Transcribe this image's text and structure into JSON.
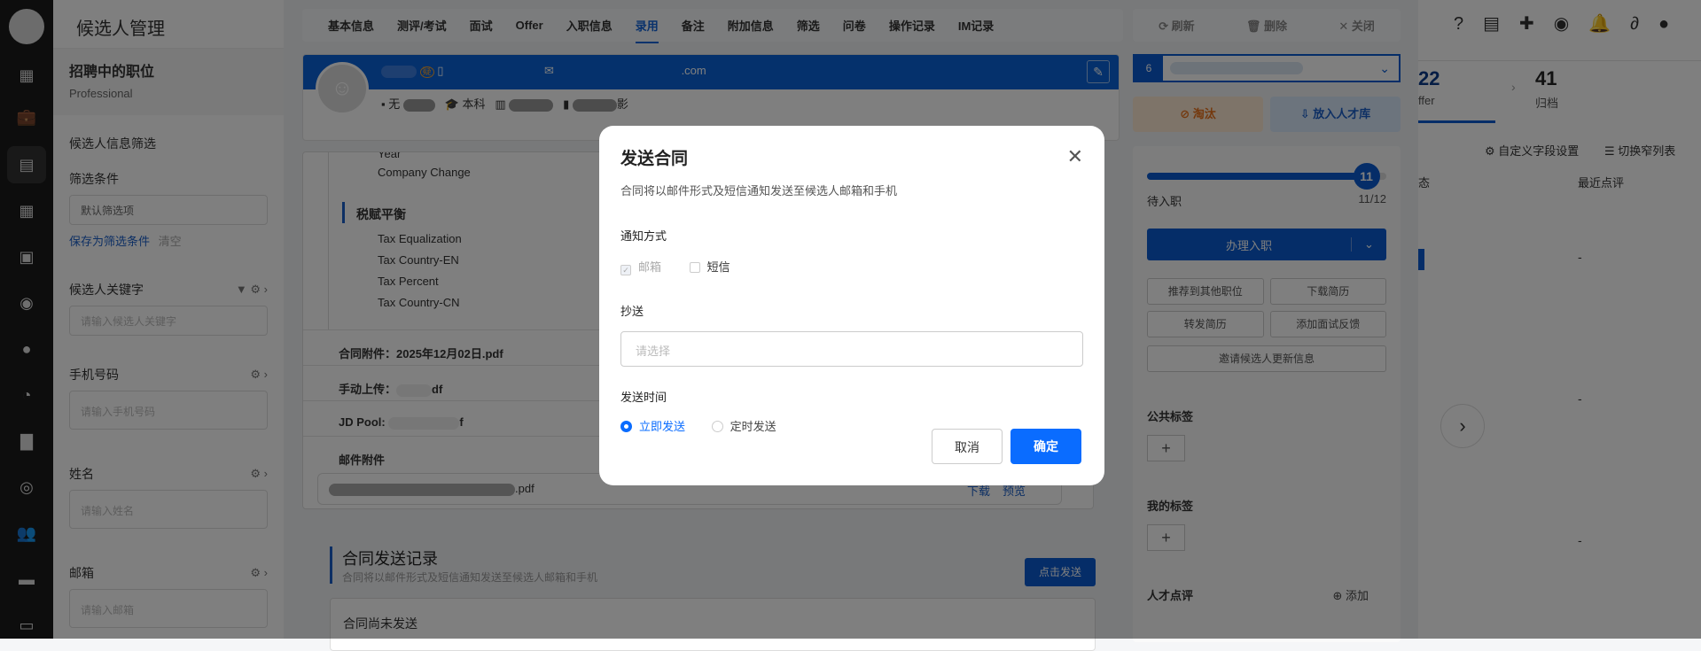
{
  "rail": {
    "icons": [
      "avatar",
      "dashboard-icon",
      "briefcase-icon",
      "candidate-icon",
      "calendar-icon",
      "contact-card-icon",
      "wechat-icon",
      "thumbs-up-icon",
      "pie-chart-icon",
      "bar-chart-icon",
      "person-circle-icon",
      "users-icon",
      "chat-icon",
      "clipboard-icon"
    ]
  },
  "filter": {
    "title": "候选人管理",
    "job_title": "招聘中的职位",
    "job_sub": "Professional",
    "info_filter": "候选人信息筛选",
    "conditions": "筛选条件",
    "default_option": "默认筛选项",
    "save": "保存为筛选条件",
    "clear": "清空",
    "fields": [
      {
        "label": "候选人关键字",
        "placeholder": "请输入候选人关键字"
      },
      {
        "label": "手机号码",
        "placeholder": "请输入手机号码"
      },
      {
        "label": "姓名",
        "placeholder": "请输入姓名"
      },
      {
        "label": "邮箱",
        "placeholder": "请输入邮箱"
      }
    ]
  },
  "tabs": [
    "基本信息",
    "测评/考试",
    "面试",
    "Offer",
    "入职信息",
    "录用",
    "备注",
    "附加信息",
    "筛选",
    "问卷",
    "操作记录",
    "IM记录"
  ],
  "active_tab": "录用",
  "candidate": {
    "badge": "疑",
    "email_suffix": ".com",
    "work": "无",
    "edu": "本科",
    "extra": "影"
  },
  "detail": {
    "rows": [
      "Year",
      "Company Change"
    ],
    "section": "税赋平衡",
    "tax": [
      "Tax Equalization",
      "Tax Country-EN",
      "Tax Percent",
      "Tax Country-CN"
    ],
    "contract_attachment": "合同附件：2025年12月02日.pdf",
    "manual_upload": "手动上传：",
    "manual_suffix": "df",
    "jd_pool": "JD Pool:",
    "jd_suffix": "f",
    "mail_attachment": "邮件附件",
    "file_suffix": ".pdf",
    "download": "下载",
    "preview": "预览"
  },
  "record": {
    "title": "合同发送记录",
    "sub": "合同将以邮件形式及短信通知发送至候选人邮箱和手机",
    "send_btn": "点击发送",
    "empty": "合同尚未发送"
  },
  "right": {
    "refresh": "刷新",
    "delete": "删除",
    "close": "关闭",
    "stage_no": "6",
    "eliminate": "淘汰",
    "talent_pool": "放入人才库",
    "progress": {
      "current": 11,
      "total": 12,
      "label": "待入职",
      "text": "11/12"
    },
    "onboard": "办理入职",
    "actions": [
      "推荐到其他职位",
      "下载简历",
      "转发简历",
      "添加面试反馈"
    ],
    "invite": "邀请候选人更新信息",
    "public_tags": "公共标签",
    "my_tags": "我的标签",
    "review": "人才点评",
    "add": "添加"
  },
  "page": {
    "offer_count": "22",
    "offer_label": "ffer",
    "archive_count": "41",
    "archive_label": "归档",
    "custom_fields": "自定义字段设置",
    "narrow_list": "切换窄列表",
    "col_status": "态",
    "col_review": "最近点评",
    "dash": "-"
  },
  "modal": {
    "title": "发送合同",
    "desc": "合同将以邮件形式及短信通知发送至候选人邮箱和手机",
    "notify_label": "通知方式",
    "email": "邮箱",
    "sms": "短信",
    "email_checked": true,
    "sms_checked": false,
    "cc_label": "抄送",
    "cc_placeholder": "请选择",
    "time_label": "发送时间",
    "now": "立即发送",
    "scheduled": "定时发送",
    "selected_time": "立即发送",
    "cancel": "取消",
    "ok": "确定"
  },
  "colors": {
    "primary": "#0a6cff",
    "brand_blue": "#0a5bd0",
    "eliminate": "#e8701a"
  }
}
